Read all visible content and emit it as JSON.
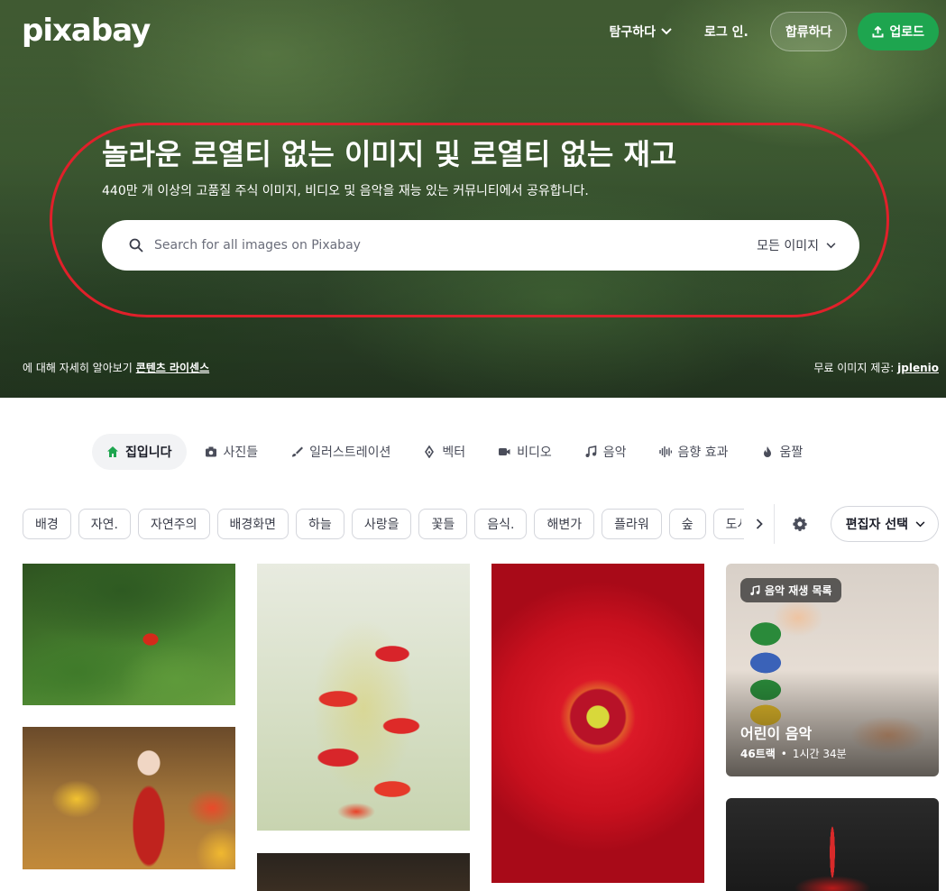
{
  "header": {
    "logo": "pixabay",
    "explore": "탐구하다",
    "login": "로그 인.",
    "join": "합류하다",
    "upload": "업로드"
  },
  "hero": {
    "title": "놀라운 로열티 없는 이미지 및 로열티 없는 재고",
    "subtitle": "440만 개 이상의 고품질 주식 이미지, 비디오 및 음악을 재능 있는 커뮤니티에서 공유합니다.",
    "search_placeholder": "Search for all images on Pixabay",
    "search_type": "모든 이미지",
    "footer_left_prefix": "에 대해 자세히 알아보기 ",
    "footer_left_link": "콘텐츠 라이센스",
    "footer_right_prefix": "무료 이미지 제공: ",
    "footer_right_link": "jplenio"
  },
  "tabs": [
    {
      "label": "집입니다",
      "icon": "home-icon",
      "active": true
    },
    {
      "label": "사진들",
      "icon": "camera-icon"
    },
    {
      "label": "일러스트레이션",
      "icon": "brush-icon"
    },
    {
      "label": "벡터",
      "icon": "pen-nib-icon"
    },
    {
      "label": "비디오",
      "icon": "video-icon"
    },
    {
      "label": "음악",
      "icon": "music-note-icon"
    },
    {
      "label": "음향 효과",
      "icon": "sound-wave-icon"
    },
    {
      "label": "움짤",
      "icon": "flame-icon"
    }
  ],
  "chips": [
    "배경",
    "자연.",
    "자연주의",
    "배경화면",
    "하늘",
    "사랑을",
    "꽃들",
    "음식.",
    "해변가",
    "플라워",
    "숲",
    "도시"
  ],
  "editor_select": "편집자 선택",
  "playlist": {
    "badge": "음악 재생 목록",
    "title": "어린이 음악",
    "tracks": "46트랙",
    "separator": "•",
    "duration": "1시간 34분"
  },
  "colors": {
    "accent": "#1ea54f",
    "annotation_ring": "#e0202a"
  }
}
